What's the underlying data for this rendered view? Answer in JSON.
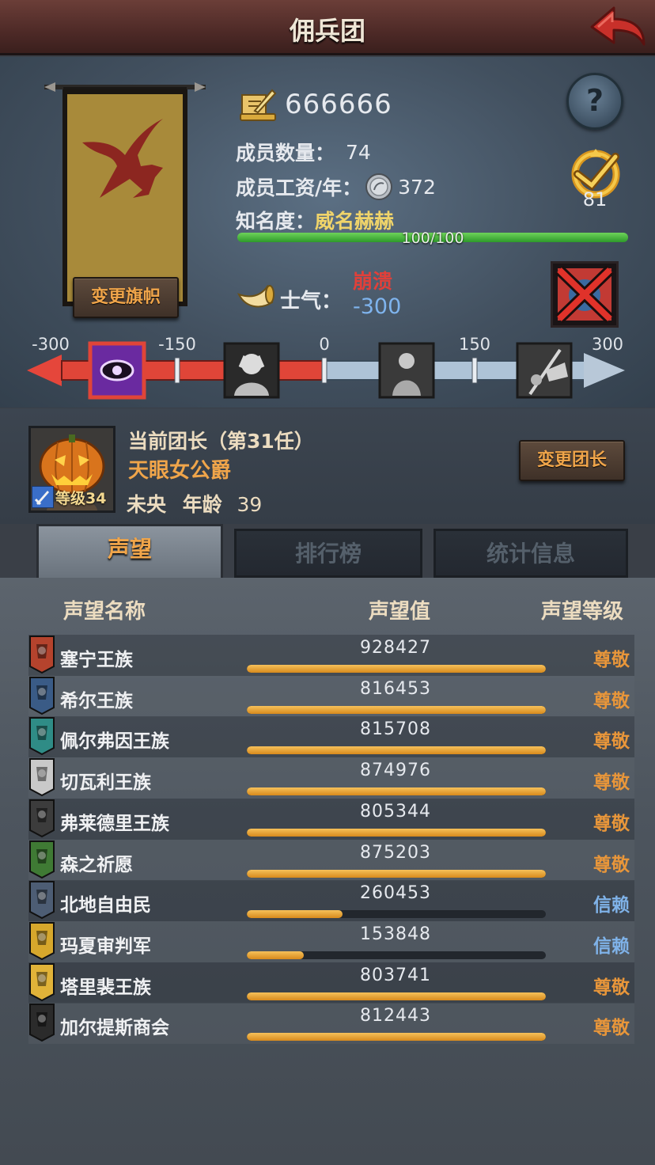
{
  "header": {
    "title": "佣兵团"
  },
  "company": {
    "funds": "666666",
    "members_label": "成员数量：",
    "members_value": "74",
    "salary_label": "成员工资/年：",
    "salary_value": "372",
    "fame_label": "知名度：",
    "fame_title": "威名赫赫",
    "fame_progress_text": "100/100",
    "fame_progress": 1.0,
    "rank_value": "81",
    "change_banner_label": "变更旗帜"
  },
  "morale": {
    "label": "士气：",
    "state": "崩溃",
    "value": "-300",
    "scale_ticks": [
      "-300",
      "-150",
      "0",
      "150",
      "300"
    ],
    "scale_values": [
      -300,
      -150,
      0,
      150,
      300
    ],
    "current": -300
  },
  "leader": {
    "title": "当前团长（第31任）",
    "name": "天眼女公爵",
    "level_text": "等级34",
    "zodiac": "未央",
    "age_label": "年龄",
    "age": "39",
    "change_leader_label": "变更团长"
  },
  "tabs": [
    {
      "label": "声望",
      "active": true
    },
    {
      "label": "排行榜",
      "active": false
    },
    {
      "label": "统计信息",
      "active": false
    }
  ],
  "reputation": {
    "headers": {
      "name": "声望名称",
      "value": "声望值",
      "level": "声望等级"
    },
    "rows": [
      {
        "name": "塞宁王族",
        "value": "928427",
        "progress": 1.0,
        "level": "尊敬",
        "level_color": "#e8963a",
        "emblem_color": "#b5432d"
      },
      {
        "name": "希尔王族",
        "value": "816453",
        "progress": 1.0,
        "level": "尊敬",
        "level_color": "#e8963a",
        "emblem_color": "#3a5b86"
      },
      {
        "name": "佩尔弗因王族",
        "value": "815708",
        "progress": 1.0,
        "level": "尊敬",
        "level_color": "#e8963a",
        "emblem_color": "#2f8c86"
      },
      {
        "name": "切瓦利王族",
        "value": "874976",
        "progress": 1.0,
        "level": "尊敬",
        "level_color": "#e8963a",
        "emblem_color": "#c9c9c9"
      },
      {
        "name": "弗莱德里王族",
        "value": "805344",
        "progress": 1.0,
        "level": "尊敬",
        "level_color": "#e8963a",
        "emblem_color": "#3c3c3c"
      },
      {
        "name": "森之祈愿",
        "value": "875203",
        "progress": 1.0,
        "level": "尊敬",
        "level_color": "#e8963a",
        "emblem_color": "#3f7a34"
      },
      {
        "name": "北地自由民",
        "value": "260453",
        "progress": 0.32,
        "level": "信赖",
        "level_color": "#7fb2e8",
        "emblem_color": "#4d5d74"
      },
      {
        "name": "玛夏审判军",
        "value": "153848",
        "progress": 0.19,
        "level": "信赖",
        "level_color": "#7fb2e8",
        "emblem_color": "#d6a72c"
      },
      {
        "name": "塔里裴王族",
        "value": "803741",
        "progress": 1.0,
        "level": "尊敬",
        "level_color": "#e8963a",
        "emblem_color": "#e1b339"
      },
      {
        "name": "加尔提斯商会",
        "value": "812443",
        "progress": 1.0,
        "level": "尊敬",
        "level_color": "#e8963a",
        "emblem_color": "#2b2b2b"
      }
    ]
  },
  "icons": {
    "back": "back-arrow-icon",
    "funds": "quill-scroll-icon",
    "help": "question-mark-icon",
    "rank": "rank-badge-icon",
    "salary": "silver-coin-icon",
    "morale": "horn-icon",
    "status": "disabled-status-icon",
    "weapon": "sword-icon"
  },
  "colors": {
    "title_bar": "#5b3430",
    "accent_orange": "#f0a54a",
    "morale_negative": "#e0403a",
    "morale_value": "#7fb4ee",
    "fame_green": "#4fbf41",
    "rep_bar": "#e9a22e"
  }
}
